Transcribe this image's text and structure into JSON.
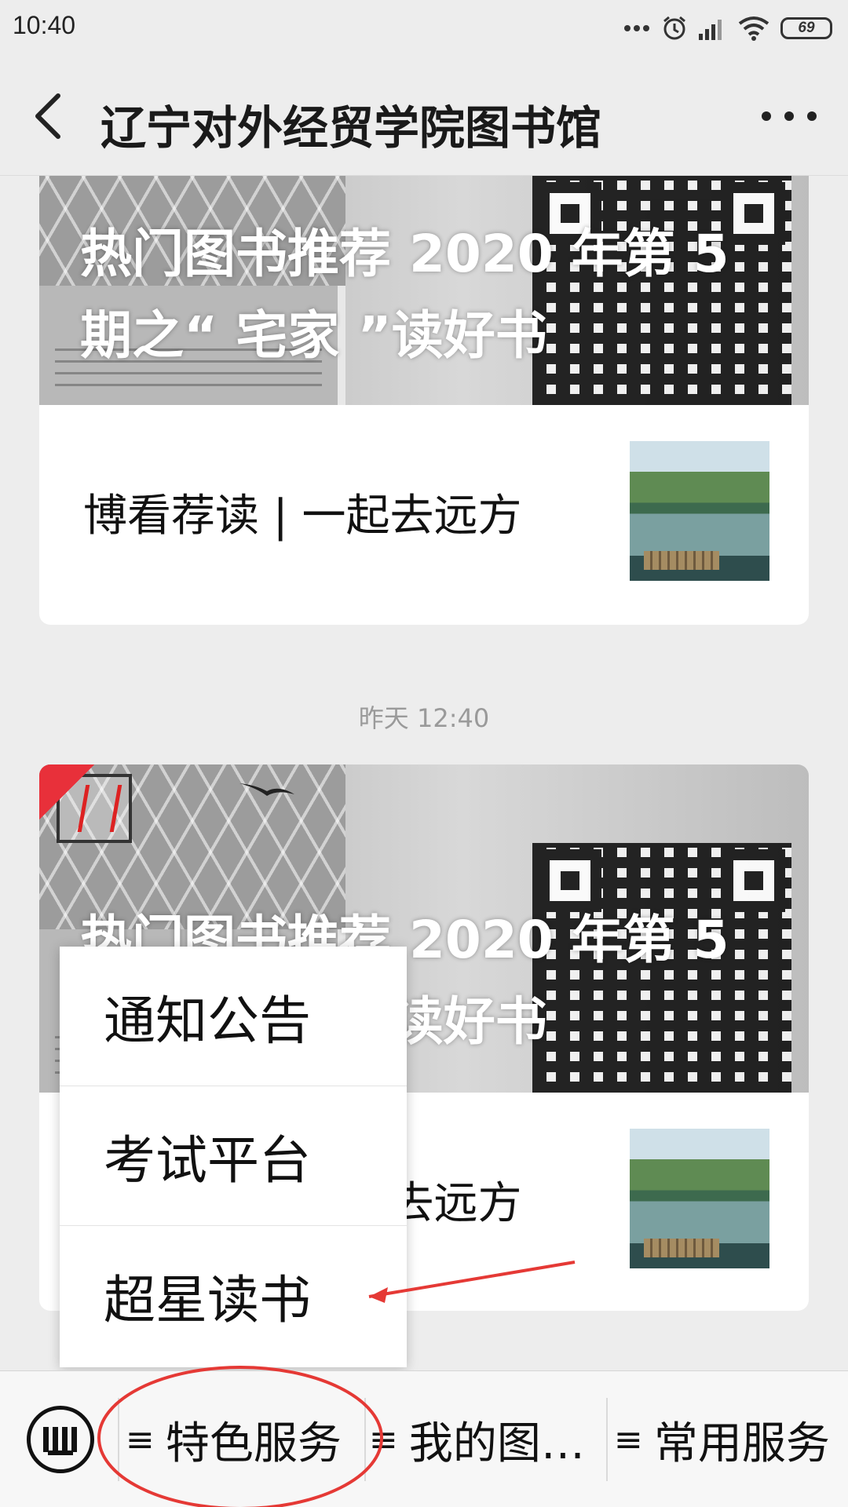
{
  "status_bar": {
    "time": "10:40",
    "battery": "69"
  },
  "header": {
    "title": "辽宁对外经贸学院图书馆"
  },
  "feed": [
    {
      "cover_title": "热门图书推荐 2020 年第 5 期之“ 宅家 ”读好书",
      "sub_title": "博看荐读 | 一起去远方"
    },
    {
      "timestamp": "昨天 12:40",
      "cover_title": "热门图书推荐 2020 年第 5 期之“ 宅家 ”读好书",
      "sub_title": "博看荐读 | 一起去远方"
    }
  ],
  "popup_menu": {
    "items": [
      "通知公告",
      "考试平台",
      "超星读书"
    ]
  },
  "bottom_menu": {
    "tabs": [
      {
        "icon": "≡",
        "label": "特色服务"
      },
      {
        "icon": "≡",
        "label": "我的图…"
      },
      {
        "icon": "≡",
        "label": "常用服务"
      }
    ]
  },
  "colors": {
    "annotation": "#e53935",
    "background": "#ededed"
  },
  "icons": [
    "back-icon",
    "more-icon",
    "keyboard-icon",
    "signal-icon",
    "wifi-icon",
    "alarm-icon",
    "battery-icon"
  ]
}
